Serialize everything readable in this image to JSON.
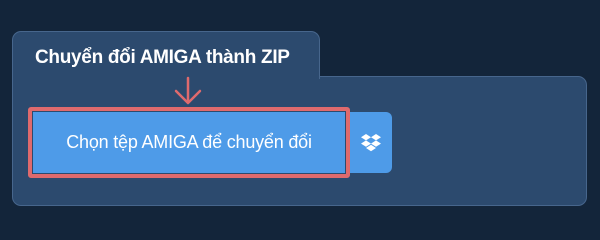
{
  "converter": {
    "tab_title": "Chuyển đổi AMIGA thành ZIP",
    "choose_file_label": "Chọn tệp AMIGA để chuyển đổi",
    "dropbox_icon": "dropbox-icon",
    "annotation_arrow": "arrow-down-icon"
  },
  "colors": {
    "background": "#13253a",
    "panel": "#2c4a6e",
    "panel_border": "#47668c",
    "button": "#4e9be8",
    "highlight": "#df6a6d"
  }
}
